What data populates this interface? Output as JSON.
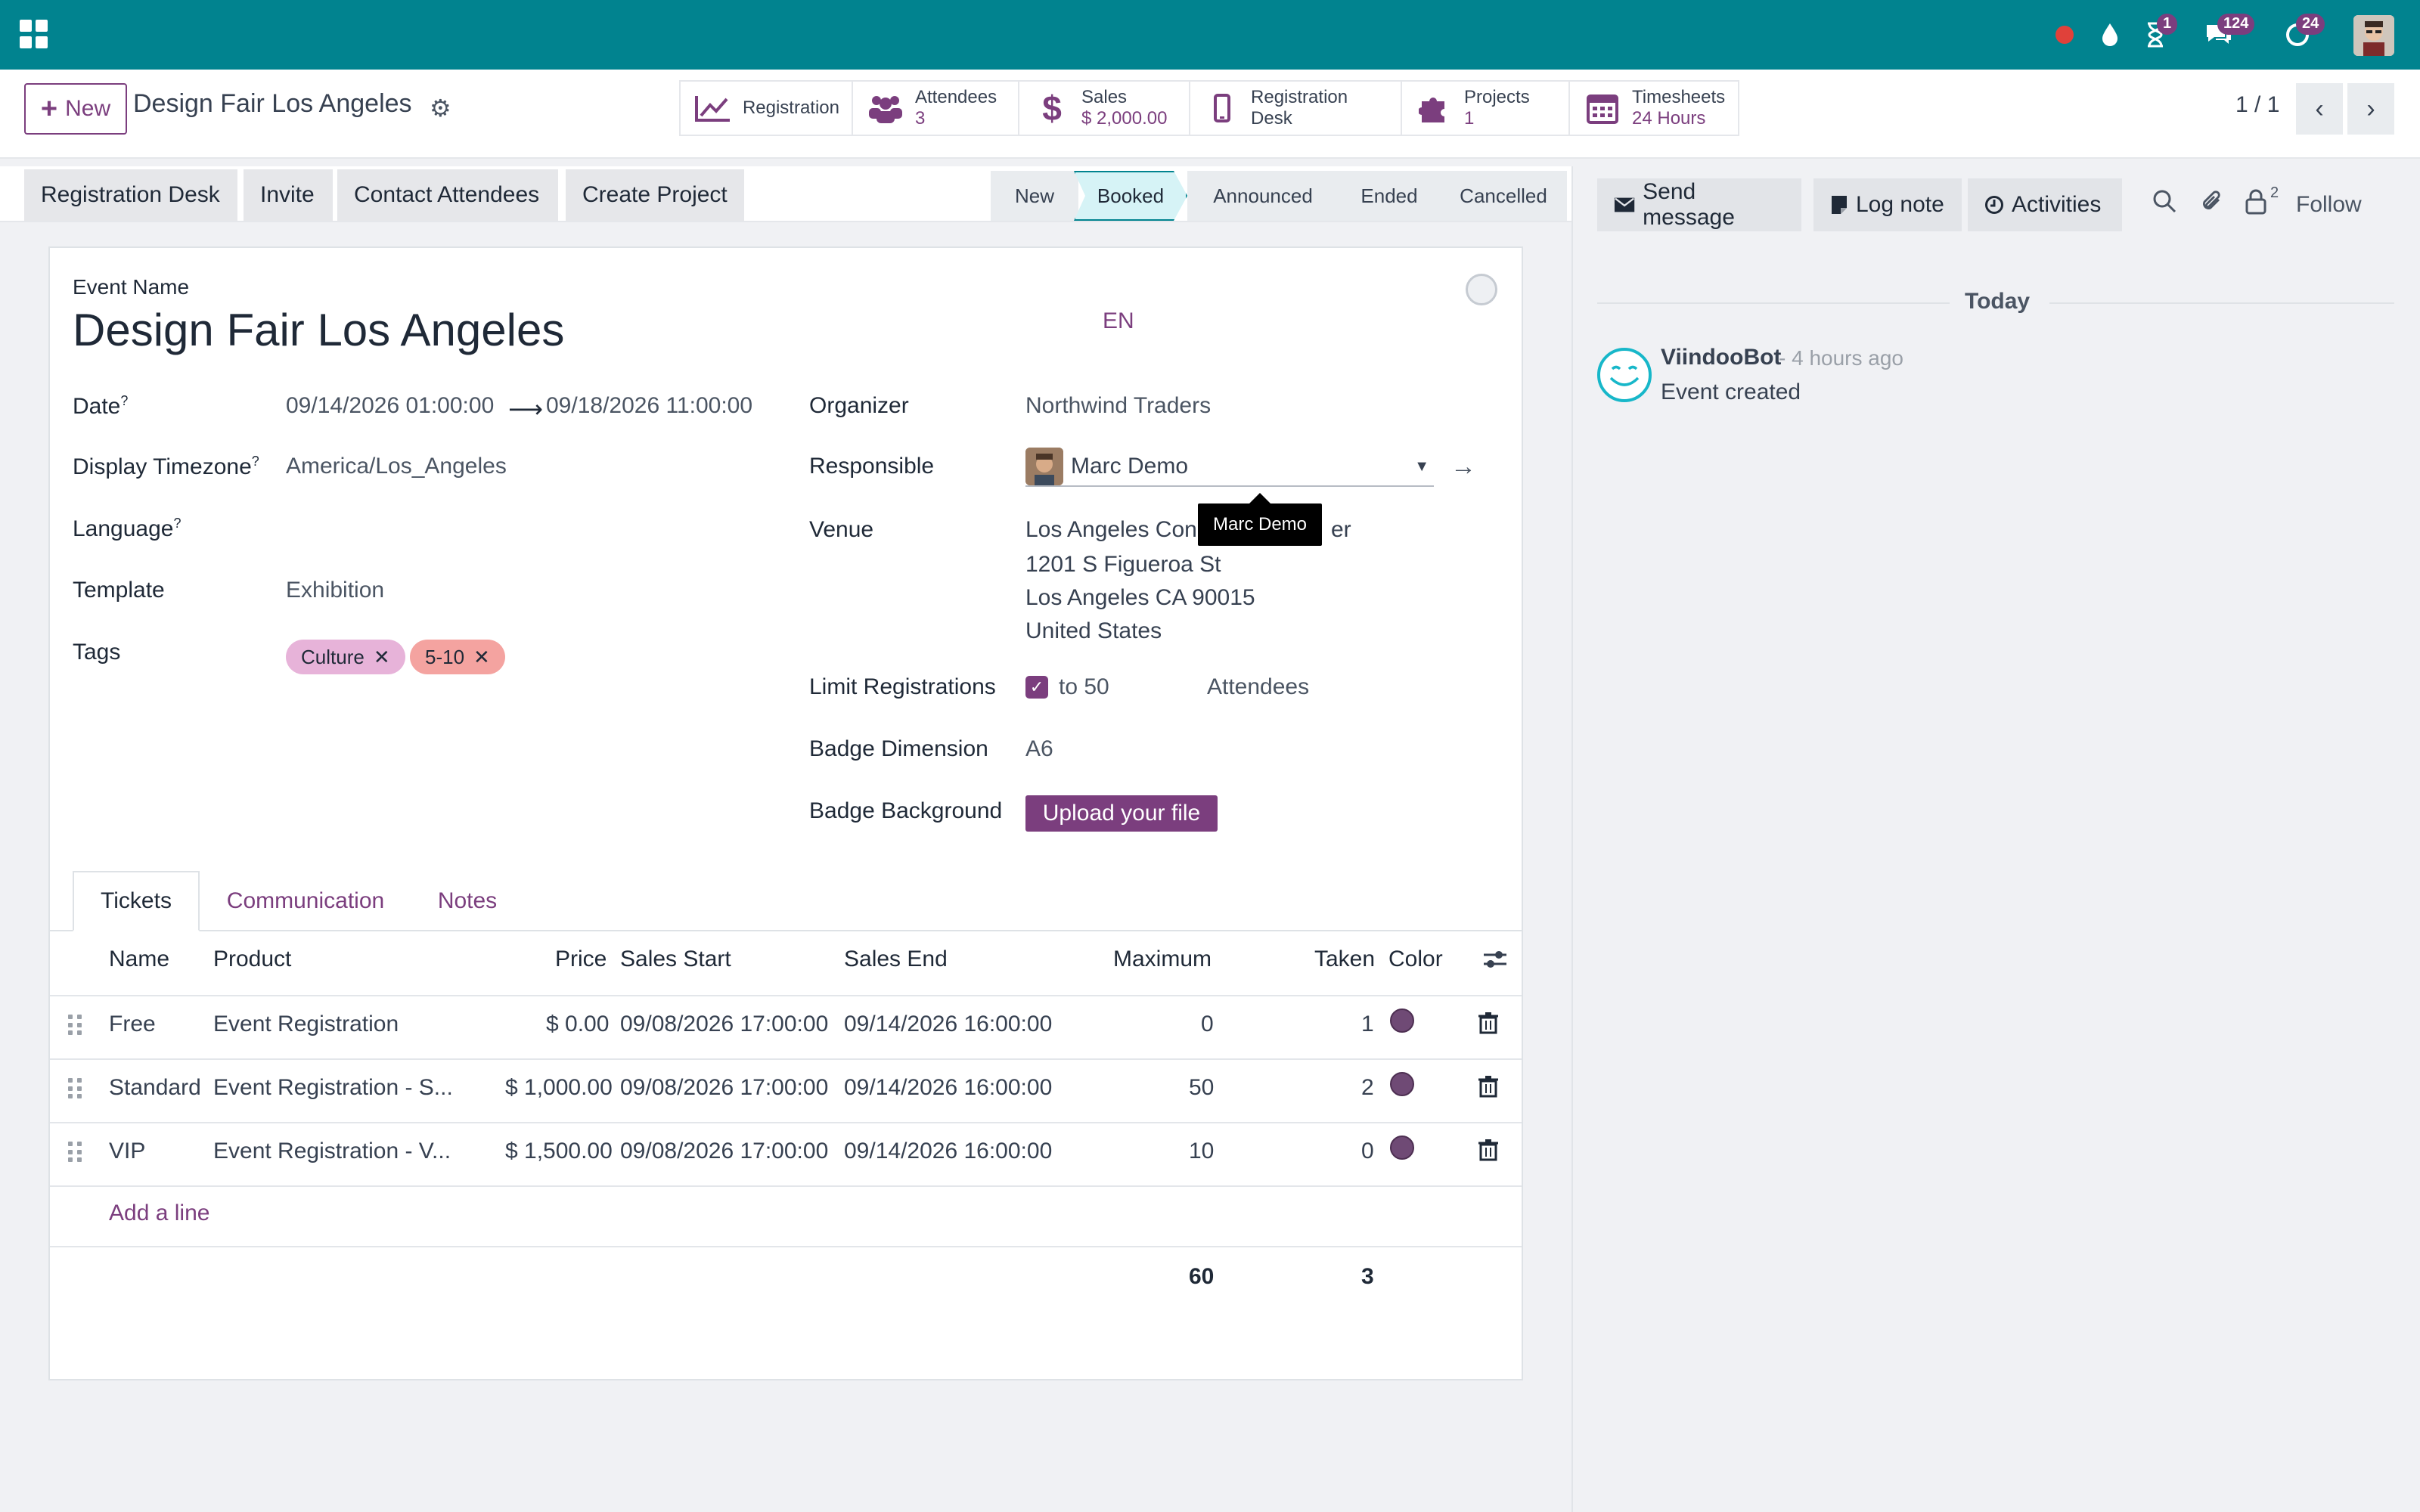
{
  "navbar": {
    "badges": {
      "activities": "1",
      "messages": "124",
      "updates": "24"
    },
    "accent": "#01838f"
  },
  "control": {
    "new_label": "New",
    "title": "Design Fair Los Angeles",
    "smart_buttons": [
      {
        "label": "Registration",
        "value": ""
      },
      {
        "label": "Attendees",
        "value": "3"
      },
      {
        "label": "Sales",
        "value": "$ 2,000.00"
      },
      {
        "label": "Registration Desk",
        "value": ""
      },
      {
        "label": "Projects",
        "value": "1"
      },
      {
        "label": "Timesheets",
        "value": "24 Hours"
      }
    ],
    "pager": "1 / 1"
  },
  "statusbar": {
    "actions": [
      "Registration Desk",
      "Invite",
      "Contact Attendees",
      "Create Project"
    ],
    "stages": [
      "New",
      "Booked",
      "Announced",
      "Ended",
      "Cancelled"
    ],
    "active_stage": "Booked"
  },
  "form": {
    "event_name_label": "Event Name",
    "event_name": "Design Fair Los Angeles",
    "lang_code": "EN",
    "date_label": "Date",
    "date_start": "09/14/2026 01:00:00",
    "date_end": "09/18/2026 11:00:00",
    "timezone_label": "Display Timezone",
    "timezone": "America/Los_Angeles",
    "language_label": "Language",
    "template_label": "Template",
    "template": "Exhibition",
    "tags_label": "Tags",
    "tags": [
      {
        "name": "Culture",
        "color": "#e7b3d9"
      },
      {
        "name": "5-10",
        "color": "#f4a3a0"
      }
    ],
    "organizer_label": "Organizer",
    "organizer": "Northwind Traders",
    "responsible_label": "Responsible",
    "responsible": "Marc Demo",
    "tooltip": "Marc Demo",
    "venue_label": "Venue",
    "venue_lines": [
      "Los Angeles Con",
      "er",
      "1201 S Figueroa St",
      "Los Angeles CA 90015",
      "United States"
    ],
    "limit_label": "Limit Registrations",
    "limit_to": "to 50",
    "limit_unit": "Attendees",
    "badge_dim_label": "Badge Dimension",
    "badge_dim": "A6",
    "badge_bg_label": "Badge Background",
    "upload_label": "Upload your file",
    "question_mark": "?"
  },
  "tabs": [
    "Tickets",
    "Communication",
    "Notes"
  ],
  "tickets": {
    "headers": [
      "Name",
      "Product",
      "Price",
      "Sales Start",
      "Sales End",
      "Maximum",
      "Taken",
      "Color"
    ],
    "rows": [
      {
        "name": "Free",
        "product": "Event Registration",
        "price": "$ 0.00",
        "start": "09/08/2026 17:00:00",
        "end": "09/14/2026 16:00:00",
        "max": "0",
        "taken": "1"
      },
      {
        "name": "Standard",
        "product": "Event Registration - S...",
        "price": "$ 1,000.00",
        "start": "09/08/2026 17:00:00",
        "end": "09/14/2026 16:00:00",
        "max": "50",
        "taken": "2"
      },
      {
        "name": "VIP",
        "product": "Event Registration - V...",
        "price": "$ 1,500.00",
        "start": "09/08/2026 17:00:00",
        "end": "09/14/2026 16:00:00",
        "max": "10",
        "taken": "0"
      }
    ],
    "add_line": "Add a line",
    "total_max": "60",
    "total_taken": "3"
  },
  "chatter": {
    "send_message": "Send message",
    "log_note": "Log note",
    "activities": "Activities",
    "followers_count": "2",
    "follow": "Follow",
    "today": "Today",
    "author": "ViindooBot",
    "time": "- 4 hours ago",
    "message": "Event created"
  }
}
